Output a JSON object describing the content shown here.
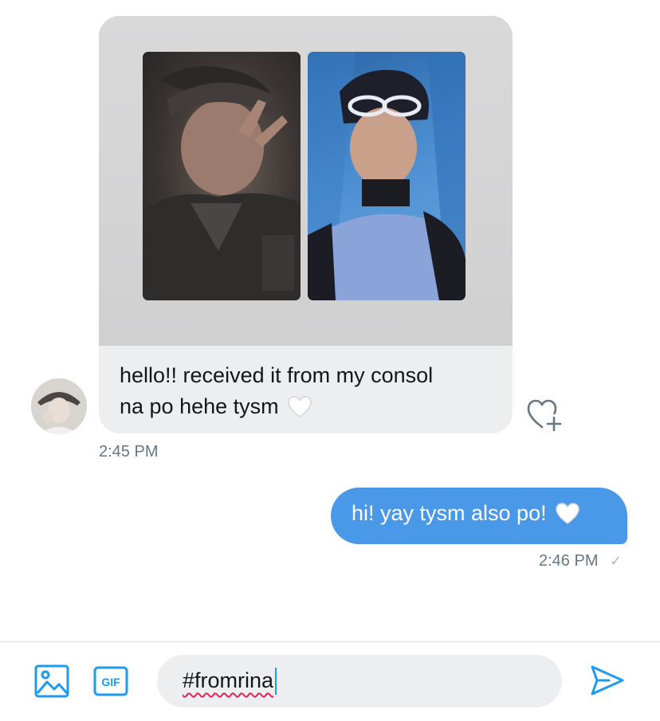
{
  "conversation": {
    "received": {
      "text_line1": "hello!! received it from my consol",
      "text_line2": "na po hehe tysm",
      "emoji": "white-heart",
      "timestamp": "2:45 PM"
    },
    "sent": {
      "text": "hi! yay tysm also po!",
      "emoji": "white-heart",
      "timestamp": "2:46 PM",
      "status": "✓"
    }
  },
  "composer": {
    "value": "#fromrina",
    "icons": [
      "image-icon",
      "gif-icon",
      "send-icon"
    ],
    "gif_label": "GIF"
  },
  "colors": {
    "accent": "#1d9bf0",
    "sent_bubble": "#4a99e9",
    "received_bubble": "#eceef0",
    "timestamp": "#657786"
  }
}
